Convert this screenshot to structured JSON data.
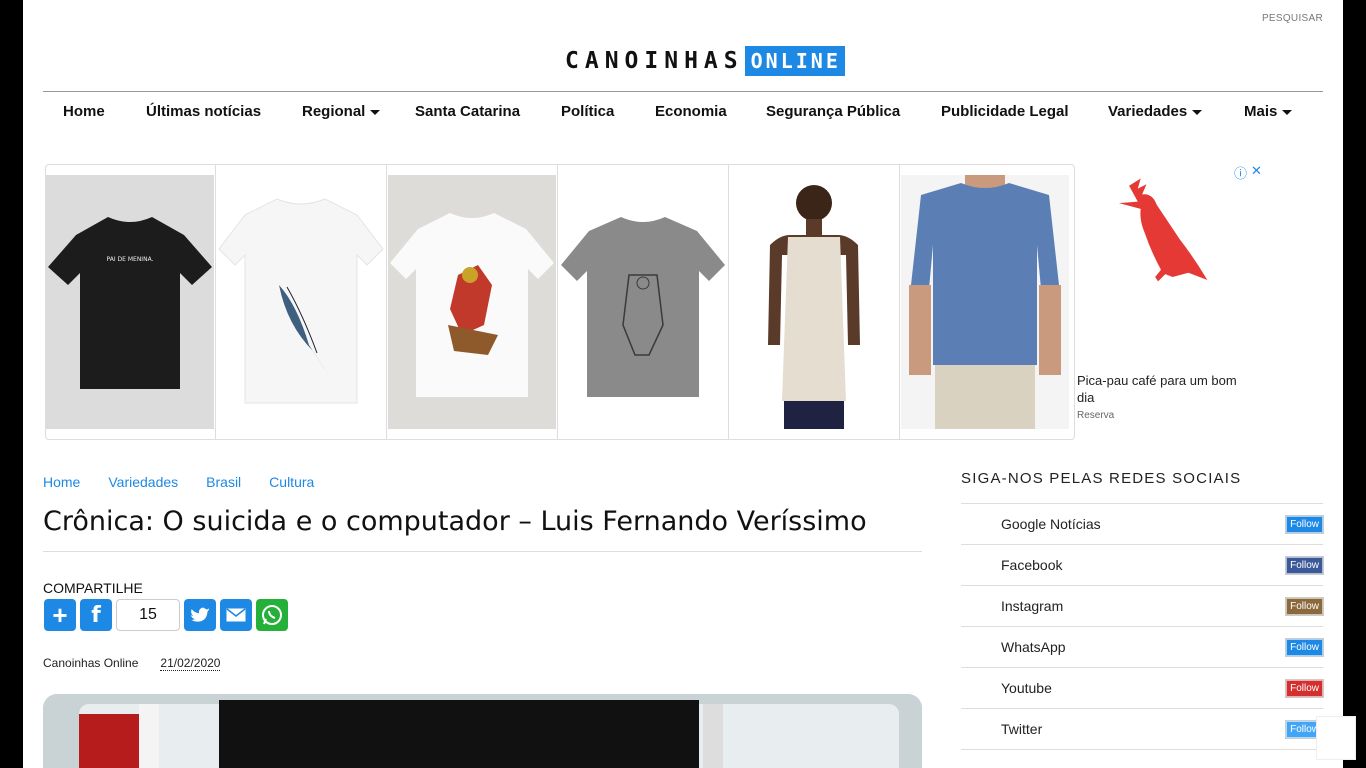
{
  "header": {
    "search_label": "PESQUISAR",
    "logo_main": "CANOINHAS",
    "logo_accent": "ONLINE",
    "brand_color": "#1e88e5"
  },
  "nav": {
    "items": [
      {
        "label": "Home",
        "dropdown": false
      },
      {
        "label": "Últimas notícias",
        "dropdown": false
      },
      {
        "label": "Regional",
        "dropdown": true
      },
      {
        "label": "Santa Catarina",
        "dropdown": false
      },
      {
        "label": "Política",
        "dropdown": false
      },
      {
        "label": "Economia",
        "dropdown": false
      },
      {
        "label": "Segurança Pública",
        "dropdown": false
      },
      {
        "label": "Publicidade Legal",
        "dropdown": false
      },
      {
        "label": "Variedades",
        "dropdown": true
      },
      {
        "label": "Mais",
        "dropdown": true
      }
    ]
  },
  "ad": {
    "products": [
      "black-tshirt",
      "white-tshirt-feather",
      "white-tshirt-bird",
      "gray-tshirt",
      "man-tank-top",
      "man-blue-tshirt"
    ],
    "tshirt_text": "PAI DE MENINA.",
    "caption": "Pica-pau café para um bom dia",
    "brand": "Reserva",
    "info_icon": "info-icon",
    "close_icon": "close-icon"
  },
  "breadcrumb": [
    "Home",
    "Variedades",
    "Brasil",
    "Cultura"
  ],
  "article": {
    "title": "Crônica: O suicida e o computador – Luis Fernando Veríssimo",
    "share_label": "COMPARTILHE",
    "share_count": "15",
    "author": "Canoinhas Online",
    "date": "21/02/2020"
  },
  "sidebar": {
    "title": "SIGA-NOS PELAS REDES SOCIAIS",
    "follow_label": "Follow",
    "networks": [
      {
        "name": "Google Notícias",
        "color": "#1e88e5"
      },
      {
        "name": "Facebook",
        "color": "#3b5998"
      },
      {
        "name": "Instagram",
        "color": "#8a6a3c"
      },
      {
        "name": "WhatsApp",
        "color": "#1e88e5"
      },
      {
        "name": "Youtube",
        "color": "#d32f2f"
      },
      {
        "name": "Twitter",
        "color": "#42a5f5"
      }
    ]
  }
}
